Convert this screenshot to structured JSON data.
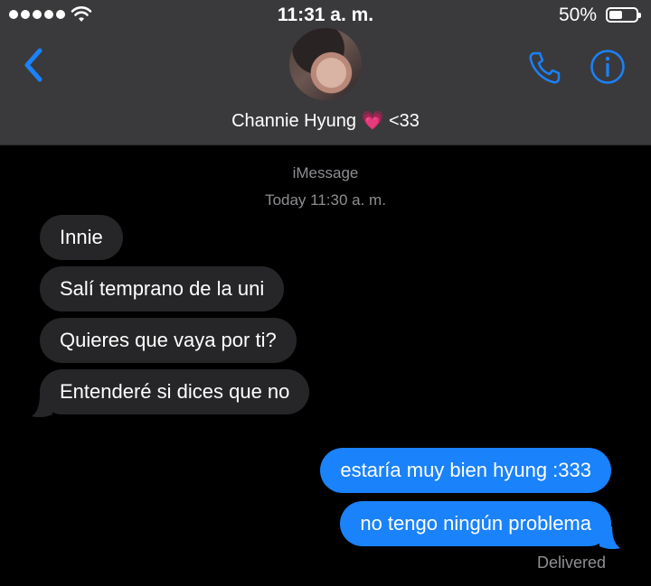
{
  "status_bar": {
    "time": "11:31 a. m.",
    "battery_percent": "50%",
    "battery_level": 0.5,
    "signal_icon": "signal-dots-icon",
    "wifi_icon": "wifi-icon"
  },
  "header": {
    "contact_name": "Channie Hyung",
    "contact_heart": "💗",
    "contact_suffix": "<33",
    "back_icon": "chevron-left-icon",
    "call_icon": "phone-icon",
    "info_icon": "info-icon"
  },
  "conversation": {
    "service": "iMessage",
    "timestamp": "Today 11:30 a. m.",
    "incoming": [
      "Innie",
      "Salí temprano de la uni",
      "Quieres que vaya por ti?",
      "Entenderé si dices que no"
    ],
    "outgoing": [
      "estaría muy bien hyung :333",
      "no tengo ningún problema"
    ],
    "status": "Delivered"
  },
  "colors": {
    "header_bg": "#3a3a3c",
    "accent": "#1a82fb",
    "incoming_bubble": "#262628",
    "muted_text": "#8e8e93"
  }
}
